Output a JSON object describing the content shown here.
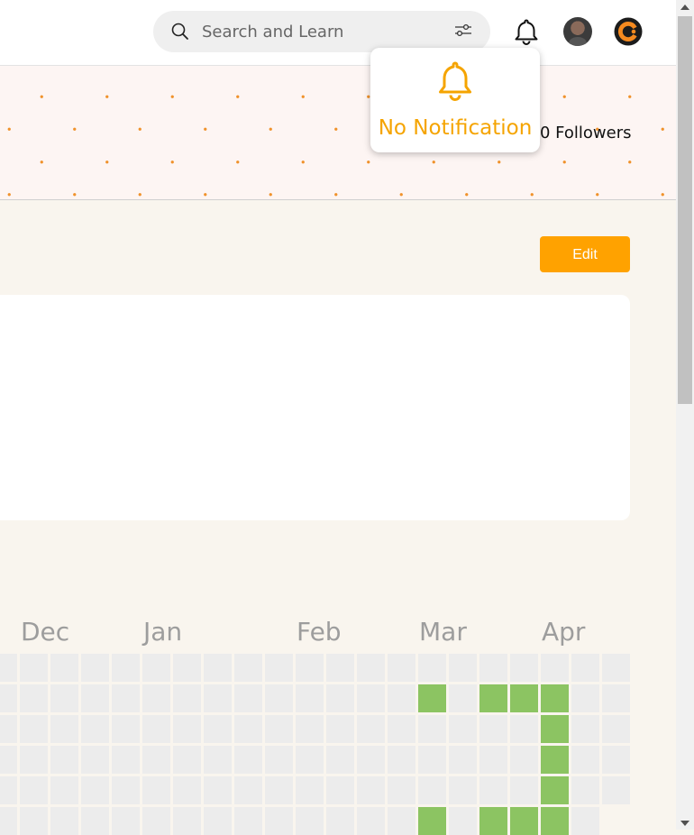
{
  "header": {
    "search": {
      "placeholder": "Search and Learn",
      "icon": "search-icon",
      "filter_icon": "sliders-icon"
    },
    "notification_icon": "bell-icon",
    "avatar": "user-avatar",
    "logo": "brand-logo"
  },
  "notification_popup": {
    "icon": "bell-icon",
    "message": "No Notification",
    "color": "#f5a400"
  },
  "profile": {
    "followers": "0 Followers",
    "edit_label": "Edit"
  },
  "colors": {
    "accent": "#ffa200",
    "activity_on": "#8cc462",
    "activity_off": "#ececec",
    "banner_dots": "#f0922b"
  },
  "activity": {
    "months": [
      "Dec",
      "Jan",
      "Feb",
      "Mar",
      "Apr"
    ],
    "active_cells": [
      {
        "week": 14,
        "day": 1
      },
      {
        "week": 16,
        "day": 1
      },
      {
        "week": 17,
        "day": 1
      },
      {
        "week": 18,
        "day": 1
      },
      {
        "week": 18,
        "day": 2
      },
      {
        "week": 18,
        "day": 3
      },
      {
        "week": 18,
        "day": 4
      },
      {
        "week": 14,
        "day": 5
      },
      {
        "week": 16,
        "day": 5
      },
      {
        "week": 17,
        "day": 5
      },
      {
        "week": 18,
        "day": 5
      }
    ]
  }
}
